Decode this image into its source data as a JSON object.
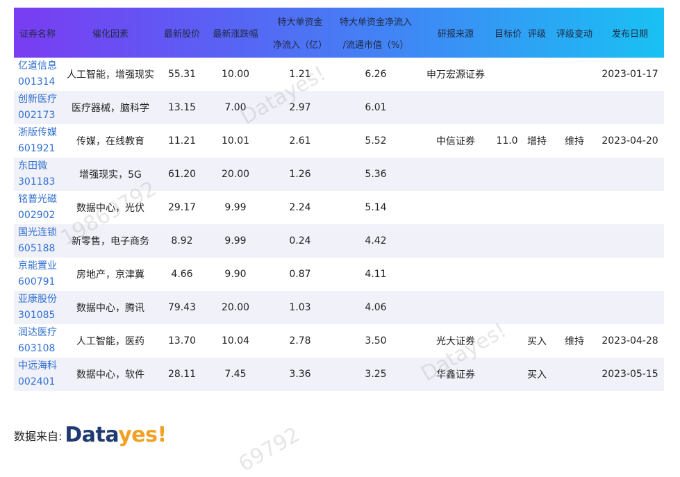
{
  "headers": {
    "name": "证券名称",
    "catalyst": "催化因素",
    "price": "最新股价",
    "change": "最新涨跌幅",
    "inflow_top": "特大单资金",
    "inflow_bottom": "净流入（亿）",
    "ratio_top": "特大单资金净流入",
    "ratio_bottom": "/流通市值（%）",
    "broker": "研报来源",
    "target": "目标价",
    "rating": "评级",
    "rating_change": "评级变动",
    "date": "发布日期"
  },
  "rows": [
    {
      "name": "亿道信息",
      "code": "001314",
      "catalyst": "人工智能，增强现实",
      "price": "55.31",
      "change": "10.00",
      "inflow": "1.21",
      "ratio": "6.26",
      "broker": "申万宏源证券",
      "target": "",
      "rating": "",
      "rating_change": "",
      "date": "2023-01-17"
    },
    {
      "name": "创新医疗",
      "code": "002173",
      "catalyst": "医疗器械，脑科学",
      "price": "13.15",
      "change": "7.00",
      "inflow": "2.97",
      "ratio": "6.01",
      "broker": "",
      "target": "",
      "rating": "",
      "rating_change": "",
      "date": ""
    },
    {
      "name": "浙版传媒",
      "code": "601921",
      "catalyst": "传媒，在线教育",
      "price": "11.21",
      "change": "10.01",
      "inflow": "2.61",
      "ratio": "5.52",
      "broker": "中信证券",
      "target": "11.0",
      "rating": "增持",
      "rating_change": "维持",
      "date": "2023-04-20"
    },
    {
      "name": "东田微",
      "code": "301183",
      "catalyst": "增强现实，5G",
      "price": "61.20",
      "change": "20.00",
      "inflow": "1.26",
      "ratio": "5.36",
      "broker": "",
      "target": "",
      "rating": "",
      "rating_change": "",
      "date": ""
    },
    {
      "name": "铭普光磁",
      "code": "002902",
      "catalyst": "数据中心，光伏",
      "price": "29.17",
      "change": "9.99",
      "inflow": "2.24",
      "ratio": "5.14",
      "broker": "",
      "target": "",
      "rating": "",
      "rating_change": "",
      "date": ""
    },
    {
      "name": "国光连锁",
      "code": "605188",
      "catalyst": "新零售，电子商务",
      "price": "8.92",
      "change": "9.99",
      "inflow": "0.24",
      "ratio": "4.42",
      "broker": "",
      "target": "",
      "rating": "",
      "rating_change": "",
      "date": ""
    },
    {
      "name": "京能置业",
      "code": "600791",
      "catalyst": "房地产，京津冀",
      "price": "4.66",
      "change": "9.90",
      "inflow": "0.87",
      "ratio": "4.11",
      "broker": "",
      "target": "",
      "rating": "",
      "rating_change": "",
      "date": ""
    },
    {
      "name": "亚康股份",
      "code": "301085",
      "catalyst": "数据中心，腾讯",
      "price": "79.43",
      "change": "20.00",
      "inflow": "1.03",
      "ratio": "4.06",
      "broker": "",
      "target": "",
      "rating": "",
      "rating_change": "",
      "date": ""
    },
    {
      "name": "润达医疗",
      "code": "603108",
      "catalyst": "人工智能，医药",
      "price": "13.70",
      "change": "10.04",
      "inflow": "2.78",
      "ratio": "3.50",
      "broker": "光大证券",
      "target": "",
      "rating": "买入",
      "rating_change": "维持",
      "date": "2023-04-28"
    },
    {
      "name": "中远海科",
      "code": "002401",
      "catalyst": "数据中心，软件",
      "price": "28.11",
      "change": "7.45",
      "inflow": "3.36",
      "ratio": "3.25",
      "broker": "华鑫证券",
      "target": "",
      "rating": "买入",
      "rating_change": "",
      "date": "2023-05-15"
    }
  ],
  "footer": {
    "source_label": "数据来自:",
    "logo_part1": "Data",
    "logo_part2": "yes!"
  },
  "watermarks": [
    "Datayes!",
    "19869792",
    "Datayes!",
    "Datayes!",
    "69792"
  ],
  "colors": {
    "header_gradient_start": "#7a3cf2",
    "header_gradient_end": "#19c1f3",
    "link_blue": "#2f6fd1",
    "row_alt": "#f1f2f9",
    "logo_navy": "#1f3a6e",
    "logo_orange": "#f0a023"
  }
}
